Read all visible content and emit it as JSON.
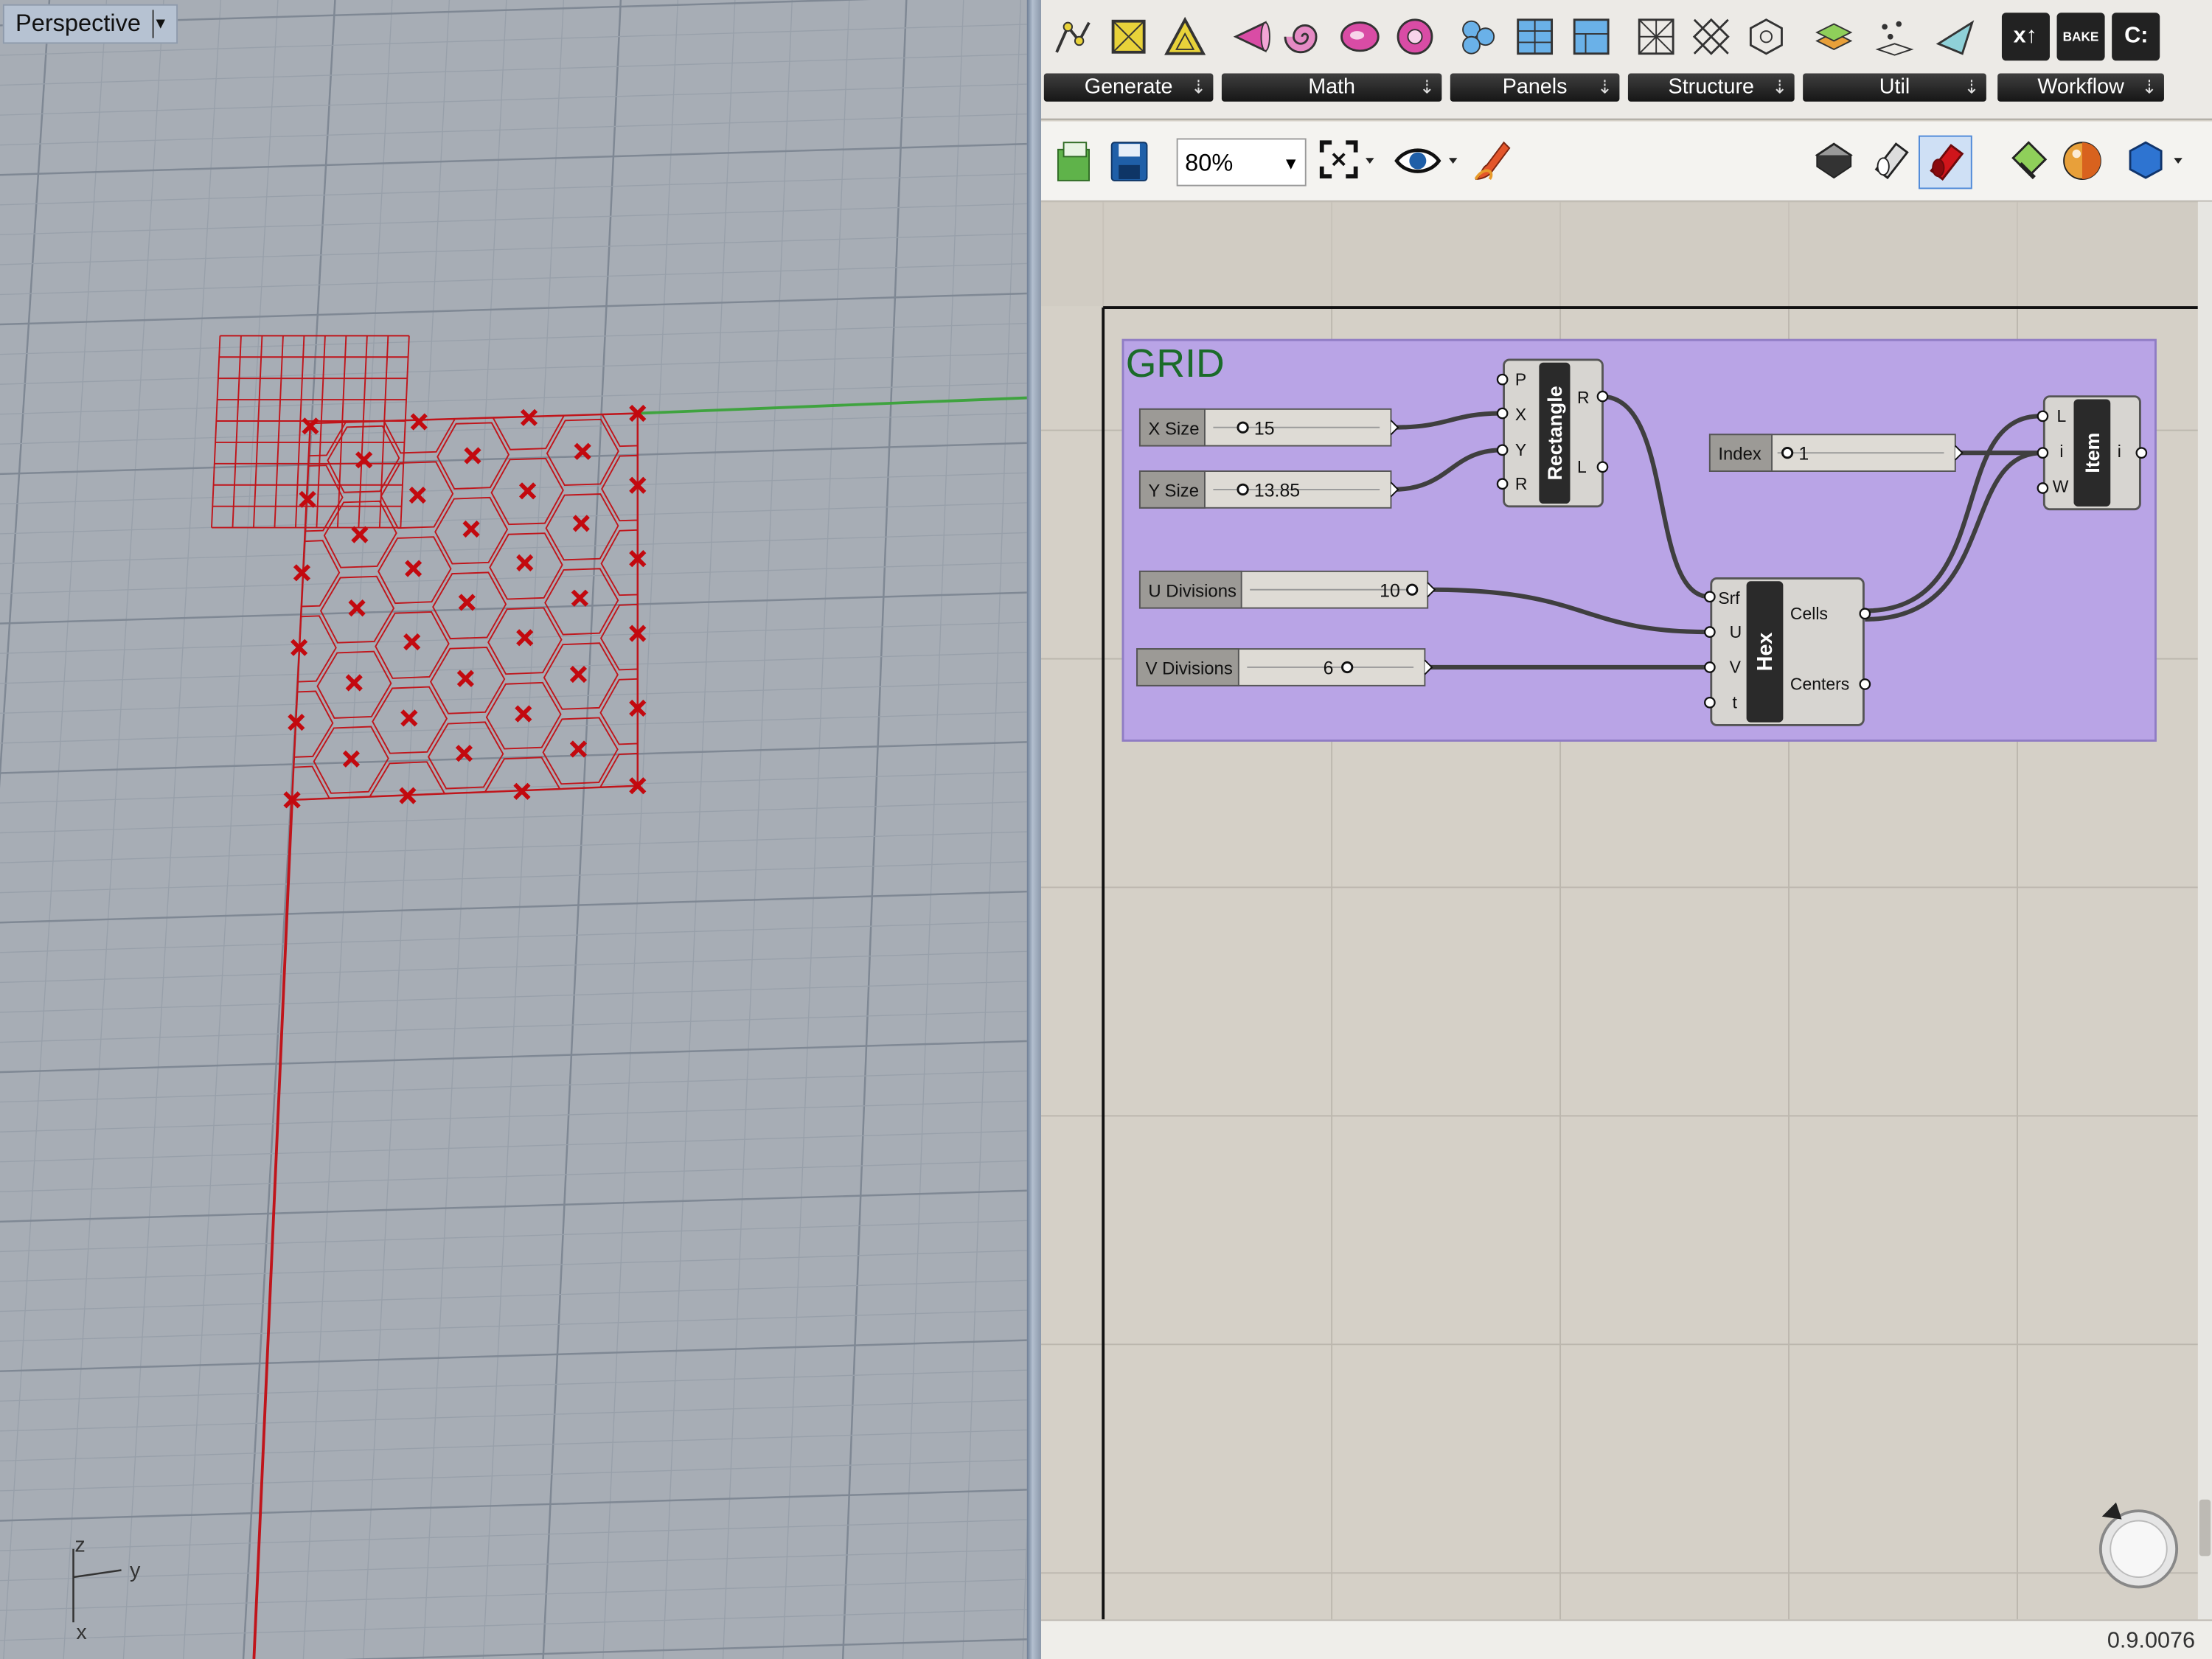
{
  "viewport": {
    "title": "Perspective",
    "axes": {
      "z": "z",
      "y": "y",
      "x": "x"
    }
  },
  "ribbon": {
    "tabs": [
      {
        "label": "Generate",
        "icons": [
          "pick-points-icon",
          "quad-icon",
          "triangle-icon"
        ]
      },
      {
        "label": "Math",
        "icons": [
          "cone-icon",
          "spiral-icon",
          "blob-icon",
          "torus-icon"
        ]
      },
      {
        "label": "Panels",
        "icons": [
          "cells-icon",
          "panel-grid-icon",
          "panel-split-icon"
        ]
      },
      {
        "label": "Structure",
        "icons": [
          "mesh-structure-icon",
          "lattice-icon",
          "hex-structure-icon"
        ]
      },
      {
        "label": "Util",
        "icons": [
          "layers-icon",
          "points-icon",
          "plane-icon"
        ]
      },
      {
        "label": "Workflow",
        "icons": [
          "export-icon",
          "bake-icon",
          "command-icon"
        ]
      }
    ],
    "workflow_icon_text": {
      "export": "x↑",
      "bake": "BAKE",
      "command": "C:"
    }
  },
  "toolbar": {
    "zoom": "80%"
  },
  "canvas": {
    "group_title": "GRID",
    "sliders": [
      {
        "name": "X Size",
        "value": "15"
      },
      {
        "name": "Y Size",
        "value": "13.85"
      },
      {
        "name": "U Divisions",
        "value": "10"
      },
      {
        "name": "V Divisions",
        "value": "6"
      },
      {
        "name": "Index",
        "value": "1"
      }
    ],
    "components": {
      "rectangle": {
        "title": "Rectangle",
        "inputs": [
          "P",
          "X",
          "Y",
          "R"
        ],
        "outputs": [
          "R",
          "L"
        ]
      },
      "hex": {
        "title": "Hex",
        "inputs": [
          "Srf",
          "U",
          "V",
          "t"
        ],
        "outputs": [
          "Cells",
          "Centers"
        ]
      },
      "item": {
        "title": "Item",
        "inputs": [
          "L",
          "i",
          "W"
        ],
        "outputs": [
          "i"
        ]
      }
    }
  },
  "status": {
    "version": "0.9.0076"
  },
  "colors": {
    "viewport_bg": "#a7adb5",
    "geometry": "#c0151b",
    "group_fill": "#b9a4e6",
    "canvas_bg": "#d5d0c7"
  }
}
